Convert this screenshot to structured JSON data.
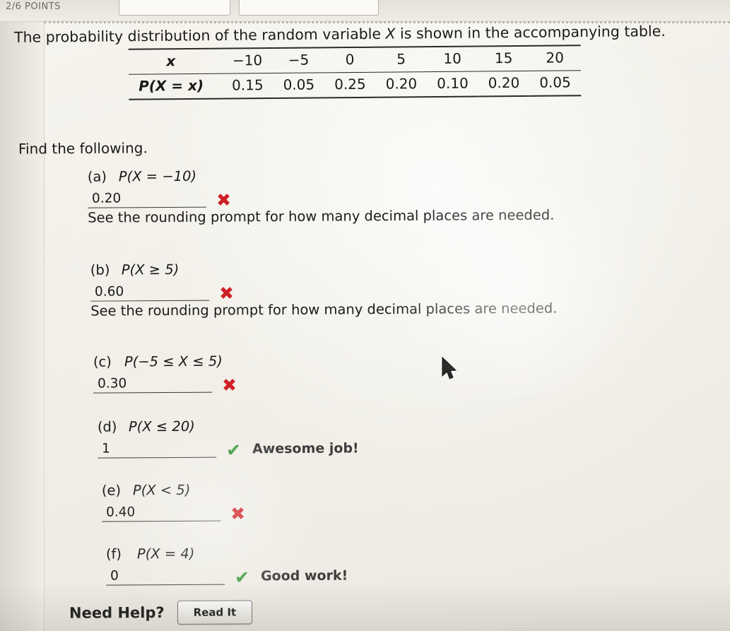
{
  "chrome": {
    "points_label": "2/6 POINTS"
  },
  "problem": {
    "intro_before": "The probability distribution of the random variable ",
    "intro_var": "X",
    "intro_after": " is shown in the accompanying table.",
    "find_following": "Find the following."
  },
  "table": {
    "row_headers": [
      "x",
      "P(X = x)"
    ],
    "x_values": [
      "−10",
      "−5",
      "0",
      "5",
      "10",
      "15",
      "20"
    ],
    "p_values": [
      "0.15",
      "0.05",
      "0.25",
      "0.20",
      "0.10",
      "0.20",
      "0.05"
    ]
  },
  "parts": [
    {
      "label": "(a)",
      "expression": "P(X = −10)",
      "answer": "0.20",
      "mark": "✖",
      "mark_type": "wrong",
      "feedback": "",
      "note": "See the rounding prompt for how many decimal places are needed."
    },
    {
      "label": "(b)",
      "expression": "P(X ≥ 5)",
      "answer": "0.60",
      "mark": "✖",
      "mark_type": "wrong",
      "feedback": "",
      "note": "See the rounding prompt for how many decimal places are needed."
    },
    {
      "label": "(c)",
      "expression": "P(−5 ≤ X ≤ 5)",
      "answer": "0.30",
      "mark": "✖",
      "mark_type": "wrong",
      "feedback": "",
      "note": ""
    },
    {
      "label": "(d)",
      "expression": "P(X ≤ 20)",
      "answer": "1",
      "mark": "✔",
      "mark_type": "right",
      "feedback": "Awesome job!",
      "note": ""
    },
    {
      "label": "(e)",
      "expression": "P(X < 5)",
      "answer": "0.40",
      "mark": "✖",
      "mark_type": "wrong",
      "feedback": "",
      "note": ""
    },
    {
      "label": "(f)",
      "expression": "P(X = 4)",
      "answer": "0",
      "mark": "✔",
      "mark_type": "right",
      "feedback": "Good work!",
      "note": ""
    }
  ],
  "footer": {
    "need_help": "Need Help?",
    "read_it": "Read It"
  },
  "colors": {
    "wrong": "#cf2027",
    "right": "#3f9b3f",
    "page": "#f2f0ea"
  }
}
